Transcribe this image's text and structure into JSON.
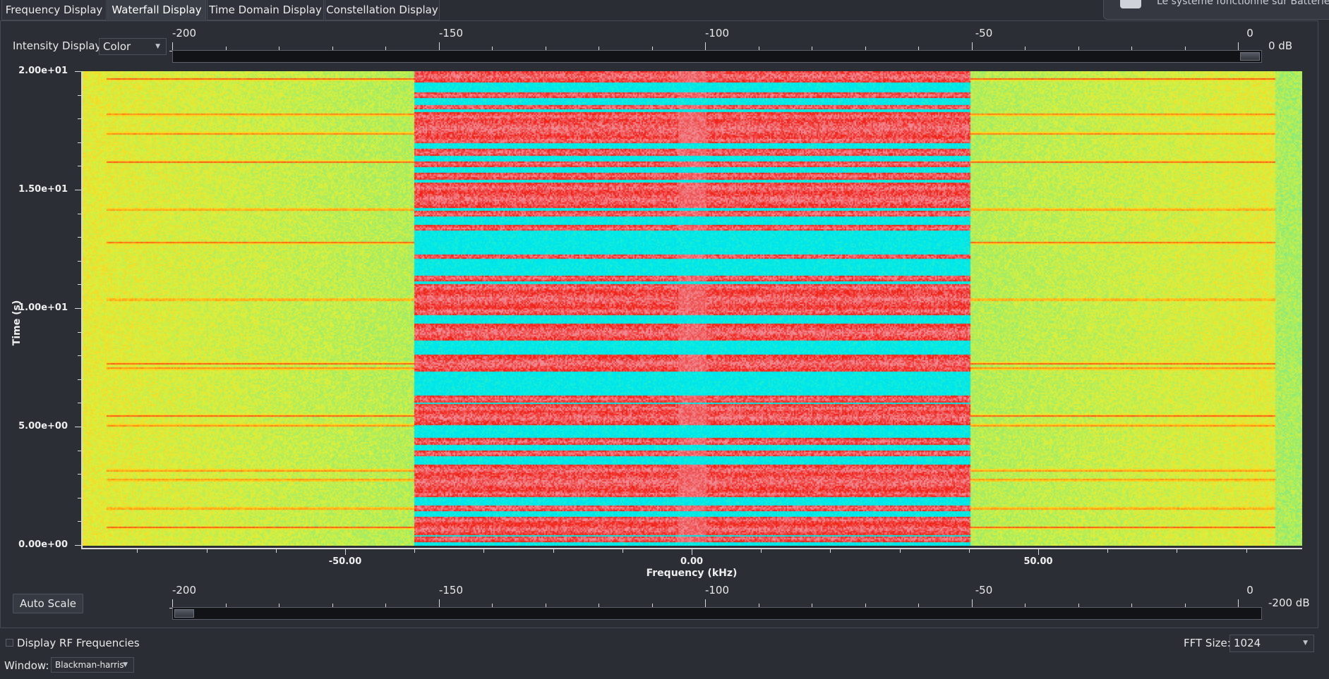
{
  "tabs": [
    {
      "label": "Frequency Display",
      "active": false
    },
    {
      "label": "Waterfall Display",
      "active": true
    },
    {
      "label": "Time Domain Display",
      "active": false
    },
    {
      "label": "Constellation Display",
      "active": false
    }
  ],
  "notification": {
    "text": "Le système fonctionne sur Batterie"
  },
  "intensity": {
    "label": "Intensity Display:",
    "value": "Color"
  },
  "top_scale": {
    "ticks": [
      "-200",
      "-150",
      "-100",
      "-50",
      "0"
    ],
    "value_label": "0 dB",
    "level_fraction": 1.0
  },
  "bottom_scale": {
    "ticks": [
      "-200",
      "-150",
      "-100",
      "-50",
      "0"
    ],
    "value_label": "-200 dB",
    "level_fraction": 0.0
  },
  "auto_scale_label": "Auto Scale",
  "display_rf_label": "Display RF Frequencies",
  "display_rf_checked": false,
  "fft": {
    "label": "FFT Size:",
    "value": "1024"
  },
  "window": {
    "label": "Window:",
    "value": "Blackman-harris"
  },
  "chart_data": {
    "type": "heatmap",
    "title": "",
    "xlabel": "Frequency (kHz)",
    "ylabel": "Time (s)",
    "x_ticks": [
      "-50.00",
      "0.00",
      "50.00"
    ],
    "y_ticks": [
      "0.00e+00",
      "5.00e+00",
      "1.00e+01",
      "1.50e+01",
      "2.00e+01"
    ],
    "xlim": [
      -88,
      88
    ],
    "ylim": [
      0,
      20
    ],
    "signal_band_khz": [
      -40,
      40
    ],
    "colors": {
      "low": "#00e5e5",
      "mid": "#c8f050",
      "high": "#ff2a10"
    }
  }
}
